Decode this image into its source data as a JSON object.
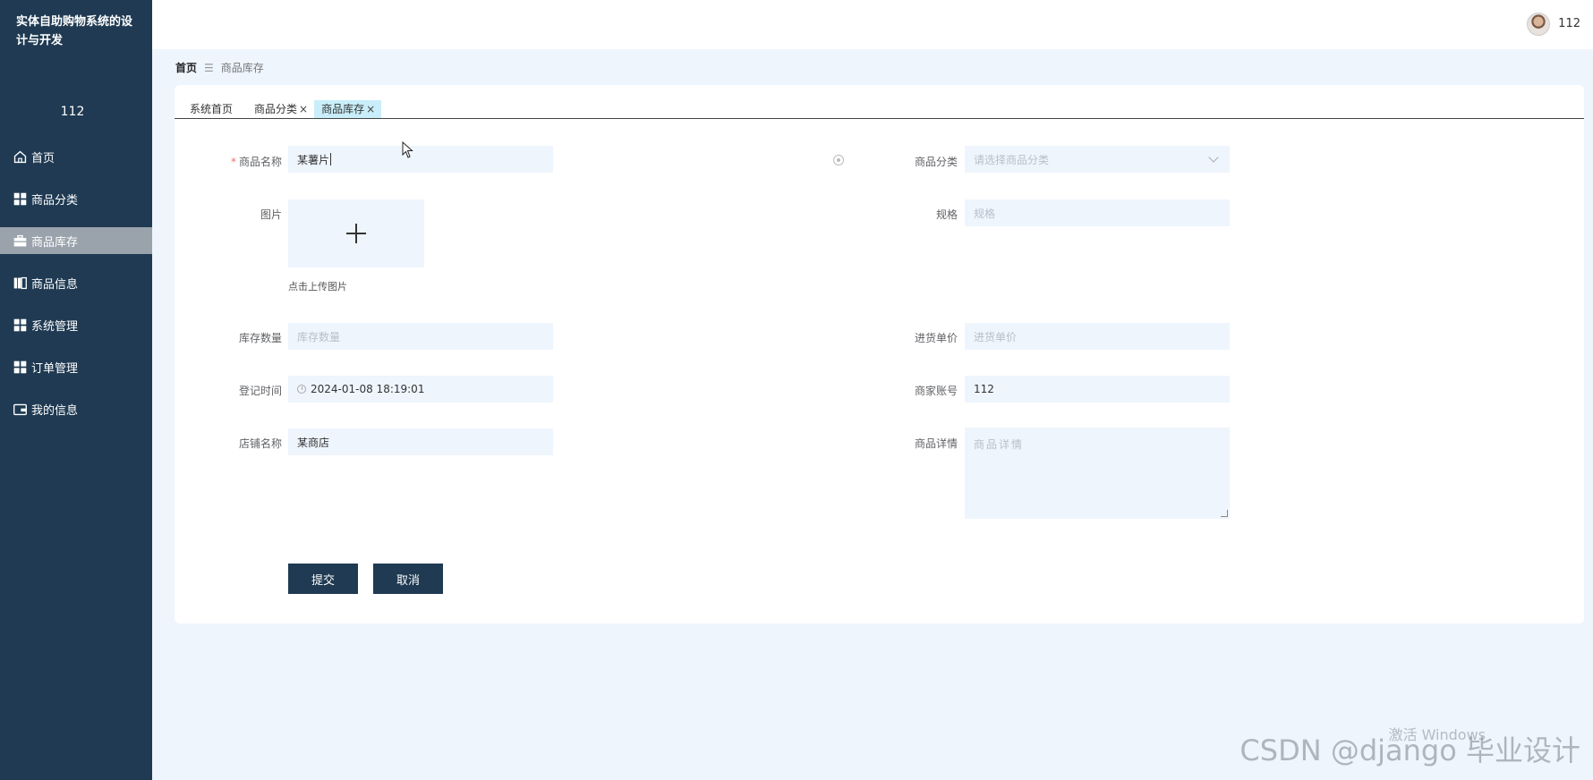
{
  "app": {
    "title": "实体自助购物系统的设计与开发",
    "user": "112"
  },
  "menu": [
    {
      "label": "首页",
      "icon": "home-icon"
    },
    {
      "label": "商品分类",
      "icon": "grid-icon"
    },
    {
      "label": "商品库存",
      "icon": "briefcase-icon",
      "active": true
    },
    {
      "label": "商品信息",
      "icon": "book-icon"
    },
    {
      "label": "系统管理",
      "icon": "grid-icon"
    },
    {
      "label": "订单管理",
      "icon": "grid-icon"
    },
    {
      "label": "我的信息",
      "icon": "wallet-icon"
    }
  ],
  "topbar": {
    "user": "112"
  },
  "breadcrumb": {
    "home": "首页",
    "current": "商品库存"
  },
  "tabs": [
    {
      "label": "系统首页"
    },
    {
      "label": "商品分类",
      "close": "×"
    },
    {
      "label": "商品库存",
      "close": "×",
      "active": true
    }
  ],
  "form": {
    "name": {
      "label": "商品名称",
      "required": "*",
      "value": "某薯片"
    },
    "category": {
      "label": "商品分类",
      "placeholder": "请选择商品分类"
    },
    "image": {
      "label": "图片",
      "tip": "点击上传图片"
    },
    "spec": {
      "label": "规格",
      "placeholder": "规格"
    },
    "stock": {
      "label": "库存数量",
      "placeholder": "库存数量"
    },
    "price": {
      "label": "进货单价",
      "placeholder": "进货单价"
    },
    "time": {
      "label": "登记时间",
      "value": "2024-01-08 18:19:01"
    },
    "merchant": {
      "label": "商家账号",
      "value": "112"
    },
    "shop": {
      "label": "店铺名称",
      "value": "某商店"
    },
    "detail": {
      "label": "商品详情",
      "placeholder": "商品详情"
    }
  },
  "buttons": {
    "submit": "提交",
    "cancel": "取消"
  },
  "watermark": {
    "text": "CSDN @django 毕业设计",
    "activate": "激活 Windows"
  }
}
